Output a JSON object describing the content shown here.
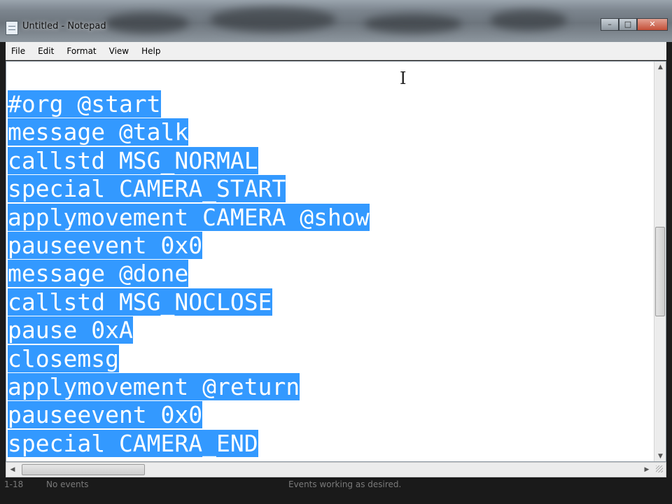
{
  "window": {
    "title": "Untitled - Notepad",
    "minimize_glyph": "–",
    "maximize_glyph": "□",
    "close_glyph": "✕"
  },
  "menu": {
    "items": [
      "File",
      "Edit",
      "Format",
      "View",
      "Help"
    ]
  },
  "editor": {
    "selection_color": "#3399ff",
    "lines": [
      "#org @start",
      "message @talk",
      "callstd MSG_NORMAL",
      "special CAMERA_START",
      "applymovement CAMERA @show",
      "pauseevent 0x0",
      "message @done",
      "callstd MSG_NOCLOSE",
      "pause 0xA",
      "closemsg",
      "applymovement @return",
      "pauseevent 0x0",
      "special CAMERA_END"
    ]
  },
  "statusbar": {
    "left": "1-18",
    "events": "No events",
    "message": "Events working as desired."
  }
}
